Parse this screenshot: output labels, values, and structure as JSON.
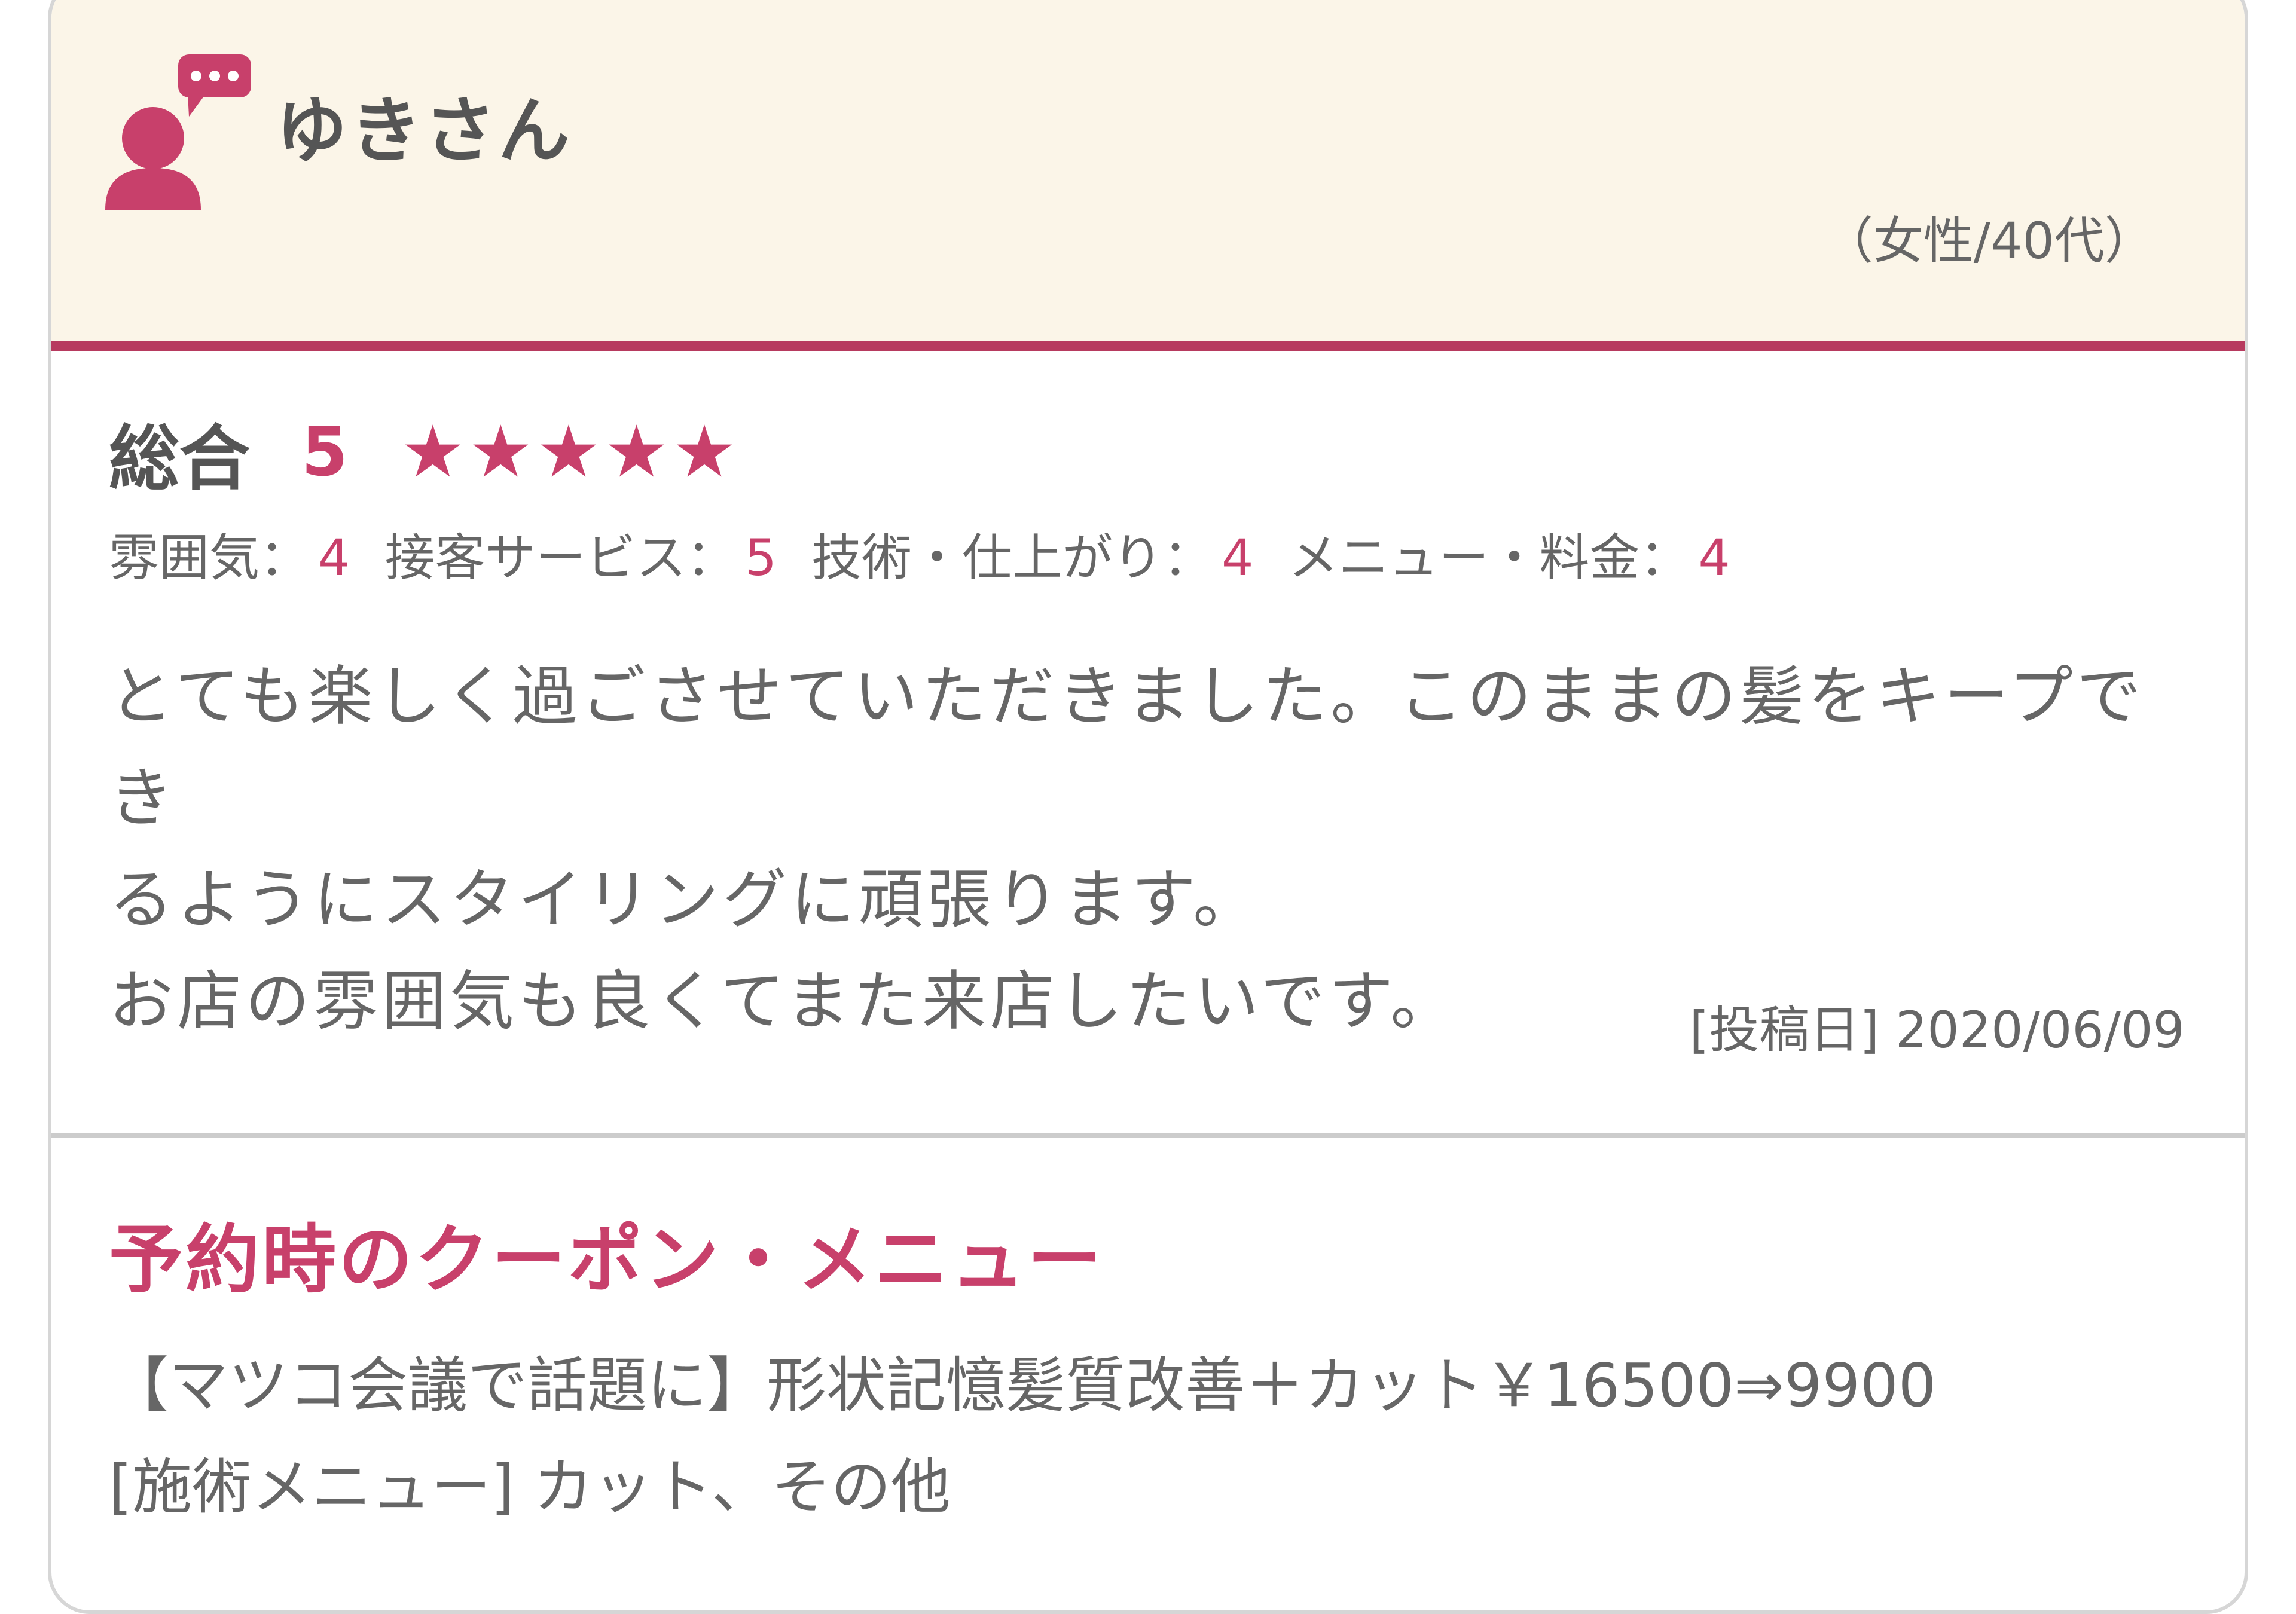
{
  "reviewer": {
    "name": "ゆきさん",
    "meta": "（女性/40代）"
  },
  "ratings": {
    "overall_label": "総合",
    "overall_score": "5",
    "stars": "★★★★★",
    "items": [
      {
        "label": "雰囲気：",
        "value": "4"
      },
      {
        "label": "接客サービス：",
        "value": "5"
      },
      {
        "label": "技術・仕上がり：",
        "value": "4"
      },
      {
        "label": "メニュー・料金：",
        "value": "4"
      }
    ]
  },
  "comment": "とても楽しく過ごさせていただきました。このままの髪をキープでき\nるようにスタイリングに頑張ります。\nお店の雰囲気も良くてまた来店したいです。",
  "post_date": "[投稿日] 2020/06/09",
  "coupon": {
    "heading": "予約時のクーポン・メニュー",
    "name": "【マツコ会議で話題に】形状記憶髪質改善＋カット￥16500⇒9900",
    "treatment": "[施術メニュー] カット、その他"
  },
  "colors": {
    "accent": "#c8406b",
    "header_bg": "#fbf5e8",
    "header_border": "#b73a5f",
    "text": "#666666"
  },
  "icons": {
    "avatar": "user-speech-bubble-icon"
  }
}
